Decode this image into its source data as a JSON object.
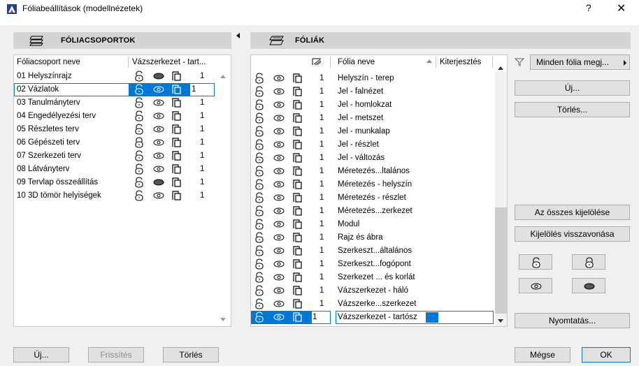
{
  "window": {
    "title": "Fóliabeállítások (modellnézetek)",
    "help": "?",
    "close": "✕"
  },
  "left_panel": {
    "header": "FÓLIACSOPORTOK",
    "columns": {
      "name": "Fóliacsoport neve",
      "props": "Vázszerkezet - tart..."
    },
    "rows": [
      {
        "name": "01 Helyszínrajz",
        "num": "1",
        "lock": "unlocked",
        "eye": "solid",
        "selected": false
      },
      {
        "name": "02 Vázlatok",
        "num": "1",
        "lock": "unlocked",
        "eye": "outline",
        "selected": true
      },
      {
        "name": "03 Tanulmányterv",
        "num": "1",
        "lock": "unlocked",
        "eye": "outline",
        "selected": false
      },
      {
        "name": "04 Engedélyezési terv",
        "num": "1",
        "lock": "unlocked",
        "eye": "outline",
        "selected": false
      },
      {
        "name": "05 Részletes terv",
        "num": "1",
        "lock": "unlocked",
        "eye": "outline",
        "selected": false
      },
      {
        "name": "06 Gépészeti terv",
        "num": "1",
        "lock": "locked",
        "eye": "outline",
        "selected": false
      },
      {
        "name": "07 Szerkezeti terv",
        "num": "1",
        "lock": "unlocked",
        "eye": "outline",
        "selected": false
      },
      {
        "name": "08 Látványterv",
        "num": "1",
        "lock": "unlocked",
        "eye": "outline",
        "selected": false
      },
      {
        "name": "09 Tervlap összeállítás",
        "num": "1",
        "lock": "unlocked",
        "eye": "solid",
        "selected": false
      },
      {
        "name": "10 3D tömör helyiségek",
        "num": "1",
        "lock": "unlocked",
        "eye": "outline",
        "selected": false
      }
    ],
    "buttons": {
      "new": "Új...",
      "refresh": "Frissítés",
      "delete": "Törlés"
    }
  },
  "right_panel": {
    "header": "FÓLIÁK",
    "columns": {
      "name": "Fólia neve",
      "ext": "Kiterjesztés"
    },
    "rows": [
      {
        "name": "Helyszín - terep",
        "num": "1"
      },
      {
        "name": "Jel - falnézet",
        "num": "1"
      },
      {
        "name": "Jel - homlokzat",
        "num": "1"
      },
      {
        "name": "Jel - metszet",
        "num": "1"
      },
      {
        "name": "Jel - munkalap",
        "num": "1"
      },
      {
        "name": "Jel - részlet",
        "num": "1"
      },
      {
        "name": "Jel - változás",
        "num": "1"
      },
      {
        "name": "Méretezés...ltalános",
        "num": "1"
      },
      {
        "name": "Méretezés - helyszín",
        "num": "1"
      },
      {
        "name": "Méretezés - részlet",
        "num": "1"
      },
      {
        "name": "Méretezés...zerkezet",
        "num": "1"
      },
      {
        "name": "Modul",
        "num": "1"
      },
      {
        "name": "Rajz és ábra",
        "num": "1"
      },
      {
        "name": "Szerkeszt...általános",
        "num": "1"
      },
      {
        "name": "Szerkeszt...fogópont",
        "num": "1"
      },
      {
        "name": "Szerkezet ... és korlát",
        "num": "1"
      },
      {
        "name": "Vázszerkezet - háló",
        "num": "1"
      },
      {
        "name": "Vázszerke...szerkezet",
        "num": "1"
      },
      {
        "name": "Vázszerkezet - tartósz",
        "num": "1",
        "selected": true
      }
    ]
  },
  "side_buttons": {
    "filter": "Minden fólia megj...",
    "new": "Új...",
    "delete": "Törlés...",
    "select_all": "Az összes kijelölése",
    "deselect": "Kijelölés visszavonása",
    "print": "Nyomtatás..."
  },
  "footer": {
    "cancel": "Mégse",
    "ok": "OK"
  },
  "colors": {
    "selection": "#0078d7",
    "header_bg": "#d4d4d4",
    "dialog_bg": "#f0f0f0"
  }
}
